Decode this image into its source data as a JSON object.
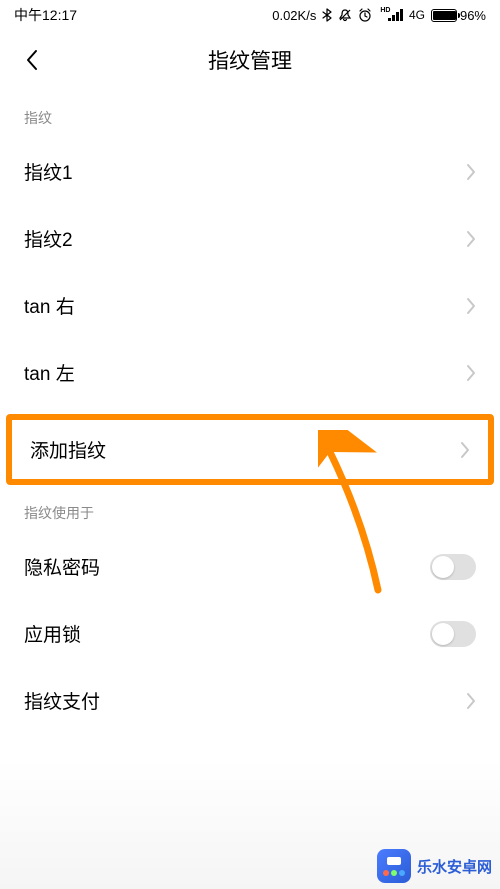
{
  "status": {
    "time": "中午12:17",
    "speed": "0.02K/s",
    "network_label": "4G",
    "hd_label": "HD",
    "battery_pct": "96%"
  },
  "header": {
    "title": "指纹管理"
  },
  "sections": {
    "fingerprints": {
      "header": "指纹",
      "items": [
        "指纹1",
        "指纹2",
        "tan 右",
        "tan 左"
      ],
      "add_label": "添加指纹"
    },
    "usage": {
      "header": "指纹使用于",
      "privacy_password": {
        "label": "隐私密码",
        "on": false
      },
      "app_lock": {
        "label": "应用锁",
        "on": false
      },
      "fingerprint_pay": {
        "label": "指纹支付"
      }
    }
  },
  "watermark": {
    "text": "乐水安卓网"
  },
  "annotation": {
    "highlight_color": "#ff8a00"
  }
}
